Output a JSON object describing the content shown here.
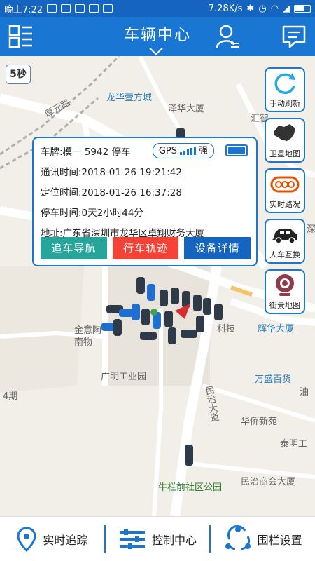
{
  "status_bar": {
    "time": "晚上7:22",
    "speed": "7.28K/s"
  },
  "header": {
    "title": "车辆中心"
  },
  "map": {
    "timer": "5秒",
    "labels": {
      "l1": "龙华壹方城",
      "l2": "泽华大厦",
      "l3": "厚元路",
      "l4": "汇智",
      "l5": "金意陶",
      "l6": "南物",
      "l7": "广明工业园",
      "l8": "辉华大厦",
      "l9": "万盛百货",
      "l10": "民治大道",
      "l11": "华侨新苑",
      "l12": "泰明工",
      "l13": "牛栏前社区公园",
      "l14": "民治商会大厦",
      "l15": "油",
      "l16": "4期",
      "l17": "科技",
      "l18": "深"
    }
  },
  "side_buttons": [
    {
      "label": "手动刷新",
      "icon": "refresh-icon"
    },
    {
      "label": "卫星地图",
      "icon": "china-map-icon"
    },
    {
      "label": "实时路况",
      "icon": "traffic-icon"
    },
    {
      "label": "人车互换",
      "icon": "car-icon"
    },
    {
      "label": "街景地图",
      "icon": "camera-icon"
    }
  ],
  "popup": {
    "plate": "车牌:模一 5942 停车",
    "gps_label": "GPS",
    "gps_strength": "强",
    "comm_time": "通讯时间:2018-01-26 19:21:42",
    "loc_time": "定位时间:2018-01-26 16:37:28",
    "park_time": "停车时间:0天2小时44分",
    "address": "地址:广东省深圳市龙华区卓翔财务大厦",
    "buttons": {
      "navigate": "追车导航",
      "track": "行车轨迹",
      "details": "设备详情"
    }
  },
  "bottom_nav": {
    "tracking": "实时追踪",
    "control": "控制中心",
    "fence": "围栏设置"
  },
  "colors": {
    "primary": "#1976d2",
    "navigate_btn": "#26a69a",
    "track_btn": "#f44336",
    "details_btn": "#1565c0"
  }
}
